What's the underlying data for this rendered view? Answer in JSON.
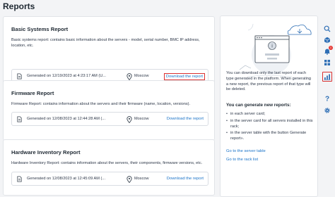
{
  "page": {
    "title": "Reports"
  },
  "reports": [
    {
      "title": "Basic Systems Report",
      "description": "Basic systems report: contains basic information about the servers - model, serial number, BMC IP address, location, etc.",
      "generated": "Generated on 12/19/2023 at 4:23:17 AM (U...",
      "location": "Moscow",
      "download_label": "Download the report"
    },
    {
      "title": "Firmware Report",
      "description": "Firmware Report: contains information about the servers and their firmware (name, location, versions).",
      "generated": "Generated on 12/08/2023 at 12:44:28 AM (...",
      "location": "Moscow",
      "download_label": "Download the report"
    },
    {
      "title": "Hardware Inventory Report",
      "description": "Hardware Inventory Report: contains information about the servers, their components, firmware versions, etc.",
      "generated": "Generated on 12/08/2023 at 12:45:09 AM (...",
      "location": "Moscow",
      "download_label": "Download the report"
    }
  ],
  "info": {
    "intro": "You can download only the last report of each type generated in the platform. When generating a new report, the previous report of that type will be deleted.",
    "heading": "You can generate new reports:",
    "items": [
      "in each server card;",
      "in the server card for all servers installed in this rack;",
      "in the server table with the button Generate report»."
    ],
    "link_servers": "Go to the server table",
    "link_racks": "Go to the rack list"
  },
  "rail": {
    "icons": [
      "search-icon",
      "cube-icon",
      "notification-icon",
      "grid-icon",
      "reports-icon",
      "help-icon",
      "settings-icon"
    ],
    "notification_count": "1"
  },
  "colors": {
    "accent": "#1a73c8",
    "highlight": "#d93030",
    "rail_icon": "#2f6fb5"
  }
}
